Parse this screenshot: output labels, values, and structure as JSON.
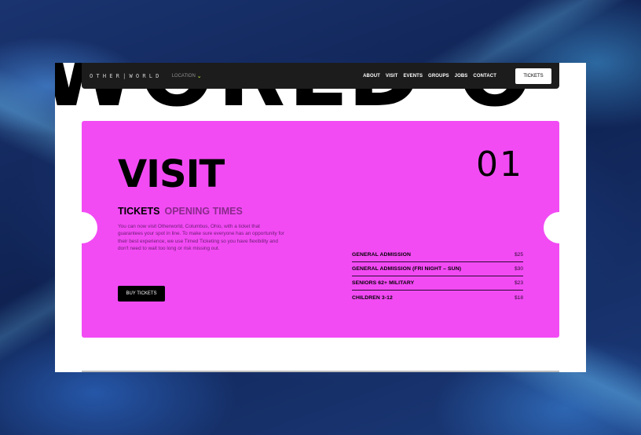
{
  "header": {
    "logo": "OTHER|WORLD",
    "location_label": "LOCATION",
    "location_icon": "chevron-down-icon",
    "nav_items": [
      "ABOUT",
      "VISIT",
      "EVENTS",
      "GROUPS",
      "JOBS",
      "CONTACT"
    ],
    "tickets_label": "TICKETS"
  },
  "hero": {
    "watermark_text": "WORLD O"
  },
  "card": {
    "title": "VISIT",
    "number": "01",
    "tabs": [
      "TICKETS",
      "OPENING TIMES"
    ],
    "description": "You can now visit Otherworld, Columbus, Ohio, with a ticket that guarantees your spot in line. To make sure everyone has an opportunity for their best experience, we use Timed Ticketing so you have flexibility and don't need to wait too long or risk missing out.",
    "buy_label": "BUY TICKETS",
    "prices": [
      {
        "name": "GENERAL ADMISSION",
        "price": "$25"
      },
      {
        "name": "GENERAL ADMISSION (FRI NIGHT – SUN)",
        "price": "$30"
      },
      {
        "name": "SENIORS 62+ MILITARY",
        "price": "$23"
      },
      {
        "name": "CHILDREN 3-12",
        "price": "$18"
      }
    ]
  },
  "colors": {
    "card_bg": "#f24bf4",
    "nav_bg": "#1c1c1c",
    "accent_chevron": "#c8ff3c",
    "background": "#152a5a"
  }
}
